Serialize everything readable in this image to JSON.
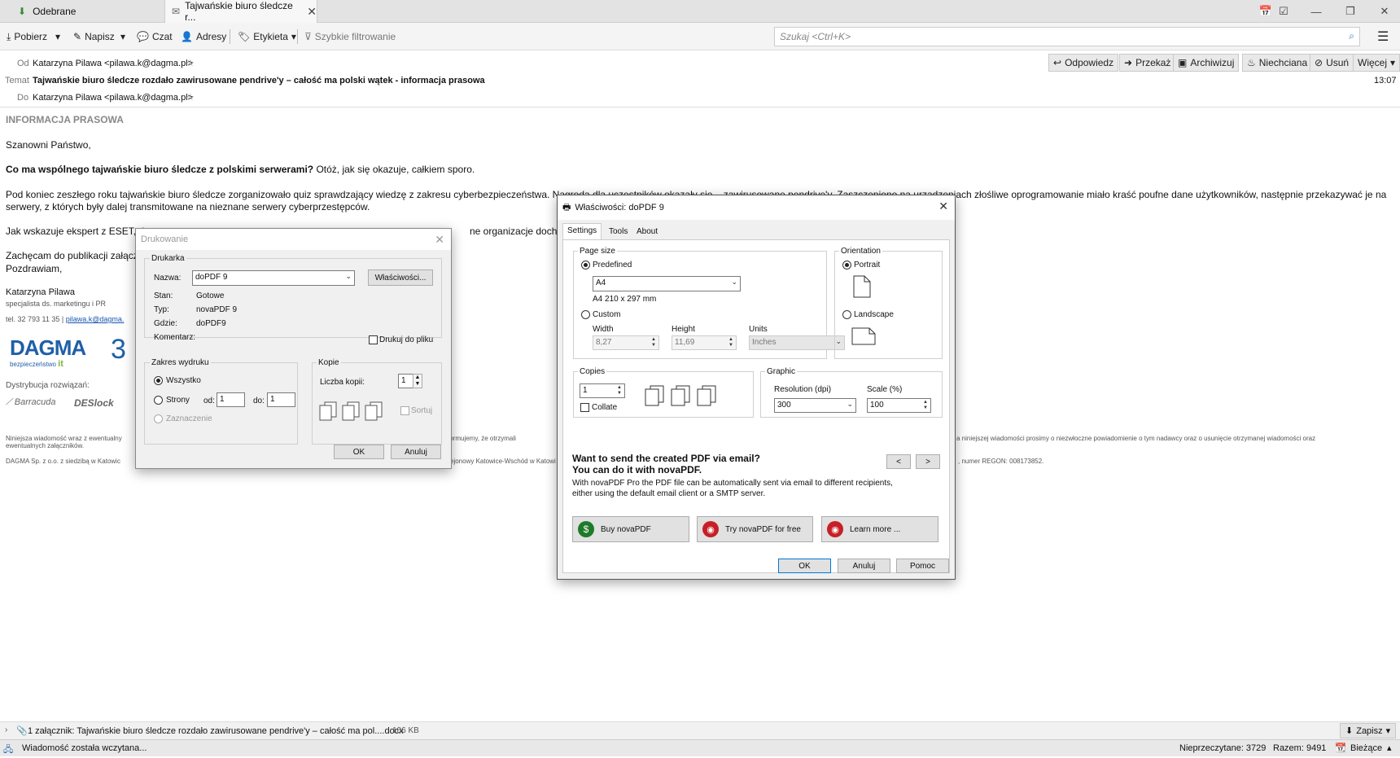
{
  "tabs": [
    {
      "label": "Odebrane"
    },
    {
      "label": "Tajwańskie biuro śledcze r..."
    }
  ],
  "toolbar": {
    "get": "Pobierz",
    "write": "Napisz",
    "chat": "Czat",
    "address": "Adresy",
    "tag": "Etykieta",
    "filter": "Szybkie filtrowanie",
    "search_placeholder": "Szukaj <Ctrl+K>"
  },
  "header": {
    "from_label": "Od",
    "from": "Katarzyna Pilawa <pilawa.k@dagma.pl>",
    "subject_label": "Temat",
    "subject": "Tajwańskie biuro śledcze rozdało zawirusowane pendrive'y – całość ma polski wątek - informacja prasowa",
    "to_label": "Do",
    "to": "Katarzyna Pilawa <pilawa.k@dagma.pl>",
    "time": "13:07",
    "actions": {
      "reply": "Odpowiedz",
      "forward": "Przekaż",
      "archive": "Archiwizuj",
      "junk": "Niechciana",
      "delete": "Usuń",
      "more": "Więcej"
    }
  },
  "body": {
    "heading": "INFORMACJA PRASOWA",
    "greeting": "Szanowni Państwo,",
    "q_bold": "Co ma wspólnego tajwańskie biuro śledcze z polskimi serwerami?",
    "q_rest": " Otóż, jak się okazuje, całkiem sporo.",
    "p1a": "Pod koniec zeszłego roku tajwańskie biuro śledcze zorganizowało quiz sprawdzający wiedzę z zakresu cyberbezpieczeństwa. Nagroda dla uczestników okazały się – zawirusowane pendrive'y. Zaszczepiono na urządzeniach złośliwe oprogramowanie miało kraść poufne dane użytkowników, następnie przekazywać je na polskie",
    "p1b": "serwery, z których były dalej transmitowane na nieznane serwery cyberprzestępców.",
    "p2": "Jak wskazuje ekspert z ESET, d",
    "p2b": "ne organizacje dochodziło",
    "p3": "Zachęcam do publikacji załącz",
    "p4": "Pozdrawiam,",
    "sig_name": "Katarzyna Pilawa",
    "sig_title": "specjalista ds. marketingu i PR",
    "sig_tel": "tel. 32 793 11 35 |",
    "sig_mail": "pilawa.k@dagma.",
    "logo": "DAGMA",
    "logo_sub": "bezpieczeństwo",
    "logo_it": "it",
    "logo_num": "3",
    "distrib": "Dystrybucja rozwiązań:",
    "brand1": "Barracuda",
    "brand2": "DESlock",
    "f1a": "Niniejsza wiadomość wraz z ewentualny",
    "f1b": "tem, informujemy, że otrzymali",
    "f1c": "a niniejszej wiadomości prosimy o niezwłoczne powiadomienie o tym nadawcy oraz o usunięcie otrzymanej wiadomości oraz",
    "f1d": "ewentualnych załączników.",
    "f2a": "DAGMA Sp. z o.o. z siedzibą w Katowic",
    "f2b": "ejonowy Katowice-Wschód w Katowi",
    "f2c": ", numer REGON: 008173852."
  },
  "print": {
    "title": "Drukowanie",
    "printer_group": "Drukarka",
    "name_label": "Nazwa:",
    "name_value": "doPDF 9",
    "props_btn": "Właściwości...",
    "state_label": "Stan:",
    "state_value": "Gotowe",
    "type_label": "Typ:",
    "type_value": "novaPDF 9",
    "where_label": "Gdzie:",
    "where_value": "doPDF9",
    "comment_label": "Komentarz:",
    "to_file": "Drukuj do pliku",
    "range_group": "Zakres wydruku",
    "all": "Wszystko",
    "pages": "Strony",
    "from_label": "od:",
    "from_value": "1",
    "to_label": "do:",
    "to_value": "1",
    "selection": "Zaznaczenie",
    "copies_group": "Kopie",
    "copies_label": "Liczba kopii:",
    "copies_value": "1",
    "collate": "Sortuj",
    "ok": "OK",
    "cancel": "Anuluj"
  },
  "props": {
    "title": "Właściwości: doPDF 9",
    "tabs": [
      "Settings",
      "Tools",
      "About"
    ],
    "page_size": "Page size",
    "predefined": "Predefined",
    "paper": "A4",
    "paper_dims": "A4 210 x 297 mm",
    "custom": "Custom",
    "width_label": "Width",
    "width_value": "8,27",
    "height_label": "Height",
    "height_value": "11,69",
    "units_label": "Units",
    "units_value": "Inches",
    "orientation": "Orientation",
    "portrait": "Portrait",
    "landscape": "Landscape",
    "copies": "Copies",
    "copies_value": "1",
    "collate": "Collate",
    "graphic": "Graphic",
    "res_label": "Resolution (dpi)",
    "res_value": "300",
    "scale_label": "Scale (%)",
    "scale_value": "100",
    "promo_title1": "Want to send the created PDF via email?",
    "promo_title2": "You can do it with novaPDF.",
    "promo_text": "With novaPDF Pro the PDF file can be automatically sent via email to different recipients, either using the default email client or a SMTP server.",
    "prev": "<",
    "next": ">",
    "buy": "Buy novaPDF",
    "try": "Try novaPDF for free",
    "learn": "Learn more ...",
    "ok": "OK",
    "cancel": "Anuluj",
    "help": "Pomoc"
  },
  "attachment": {
    "text": "1 załącznik: Tajwańskie biuro śledcze rozdało zawirusowane pendrive'y – całość ma pol....docx",
    "size": "106 KB",
    "save": "Zapisz"
  },
  "status": {
    "text": "Wiadomość została wczytana...",
    "unread": "Nieprzeczytane: 3729",
    "total": "Razem: 9491",
    "current": "Bieżące"
  }
}
